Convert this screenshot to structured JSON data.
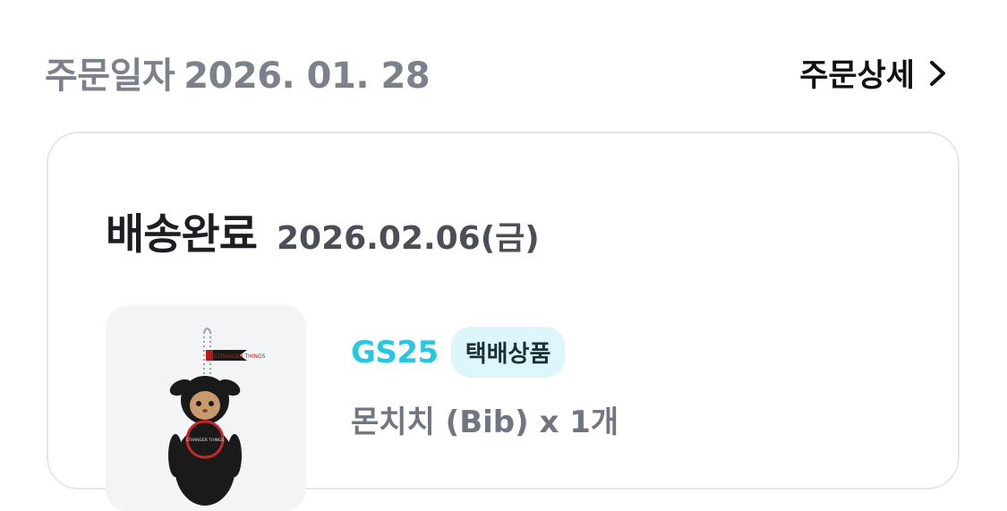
{
  "order": {
    "date_label": "주문일자",
    "date_value": "2026. 01. 28",
    "detail_link_label": "주문상세"
  },
  "shipment": {
    "status": "배송완료",
    "status_date": "2026.02.06(금)"
  },
  "product": {
    "store": "GS25",
    "badge": "택배상품",
    "name": "몬치치 (Bib) x 1개",
    "image": "monchhichi-keychain-doll",
    "image_label": "STRANGER THINGS"
  },
  "colors": {
    "store_accent": "#27c7e2",
    "badge_background": "#dcf6fb",
    "muted_text": "#7b828b",
    "card_border": "#e5e6f0"
  }
}
